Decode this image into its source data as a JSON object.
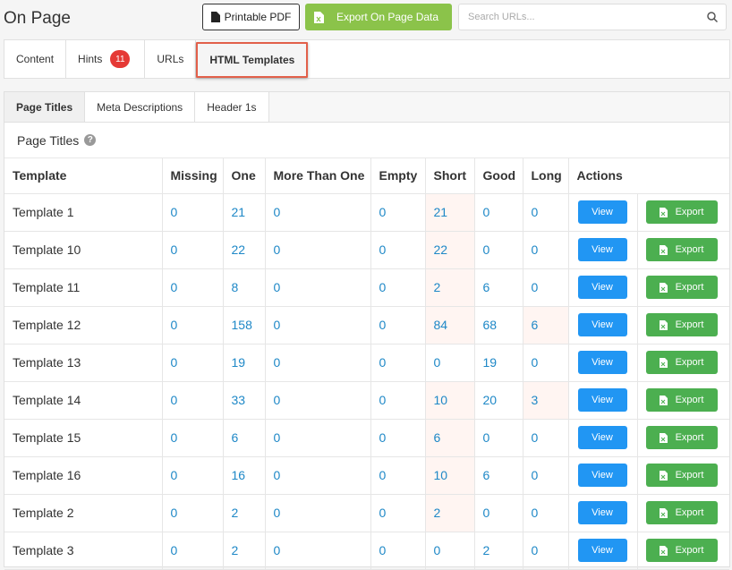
{
  "header": {
    "title": "On Page",
    "printable_pdf": "Printable PDF",
    "export_data": "Export On Page Data",
    "search_placeholder": "Search URLs..."
  },
  "top_tabs": [
    {
      "label": "Content"
    },
    {
      "label": "Hints",
      "badge": "11"
    },
    {
      "label": "URLs"
    },
    {
      "label": "HTML Templates",
      "active": true
    }
  ],
  "sub_tabs": [
    {
      "label": "Page Titles",
      "active": true
    },
    {
      "label": "Meta Descriptions"
    },
    {
      "label": "Header 1s"
    }
  ],
  "section": {
    "title": "Page Titles"
  },
  "table": {
    "columns": [
      "Template",
      "Missing",
      "One",
      "More Than One",
      "Empty",
      "Short",
      "Good",
      "Long",
      "Actions"
    ],
    "view_label": "View",
    "export_label": "Export",
    "rows": [
      {
        "template": "Template 1",
        "missing": "0",
        "one": "21",
        "more": "0",
        "empty": "0",
        "short": "21",
        "good": "0",
        "long": "0"
      },
      {
        "template": "Template 10",
        "missing": "0",
        "one": "22",
        "more": "0",
        "empty": "0",
        "short": "22",
        "good": "0",
        "long": "0"
      },
      {
        "template": "Template 11",
        "missing": "0",
        "one": "8",
        "more": "0",
        "empty": "0",
        "short": "2",
        "good": "6",
        "long": "0"
      },
      {
        "template": "Template 12",
        "missing": "0",
        "one": "158",
        "more": "0",
        "empty": "0",
        "short": "84",
        "good": "68",
        "long": "6"
      },
      {
        "template": "Template 13",
        "missing": "0",
        "one": "19",
        "more": "0",
        "empty": "0",
        "short": "0",
        "good": "19",
        "long": "0"
      },
      {
        "template": "Template 14",
        "missing": "0",
        "one": "33",
        "more": "0",
        "empty": "0",
        "short": "10",
        "good": "20",
        "long": "3"
      },
      {
        "template": "Template 15",
        "missing": "0",
        "one": "6",
        "more": "0",
        "empty": "0",
        "short": "6",
        "good": "0",
        "long": "0"
      },
      {
        "template": "Template 16",
        "missing": "0",
        "one": "16",
        "more": "0",
        "empty": "0",
        "short": "10",
        "good": "6",
        "long": "0"
      },
      {
        "template": "Template 2",
        "missing": "0",
        "one": "2",
        "more": "0",
        "empty": "0",
        "short": "2",
        "good": "0",
        "long": "0"
      },
      {
        "template": "Template 3",
        "missing": "0",
        "one": "2",
        "more": "0",
        "empty": "0",
        "short": "0",
        "good": "2",
        "long": "0"
      }
    ]
  },
  "colors": {
    "accent_blue": "#2196f3",
    "export_green": "#4caf50",
    "badge_red": "#e53935",
    "highlight": "#e2604a"
  }
}
